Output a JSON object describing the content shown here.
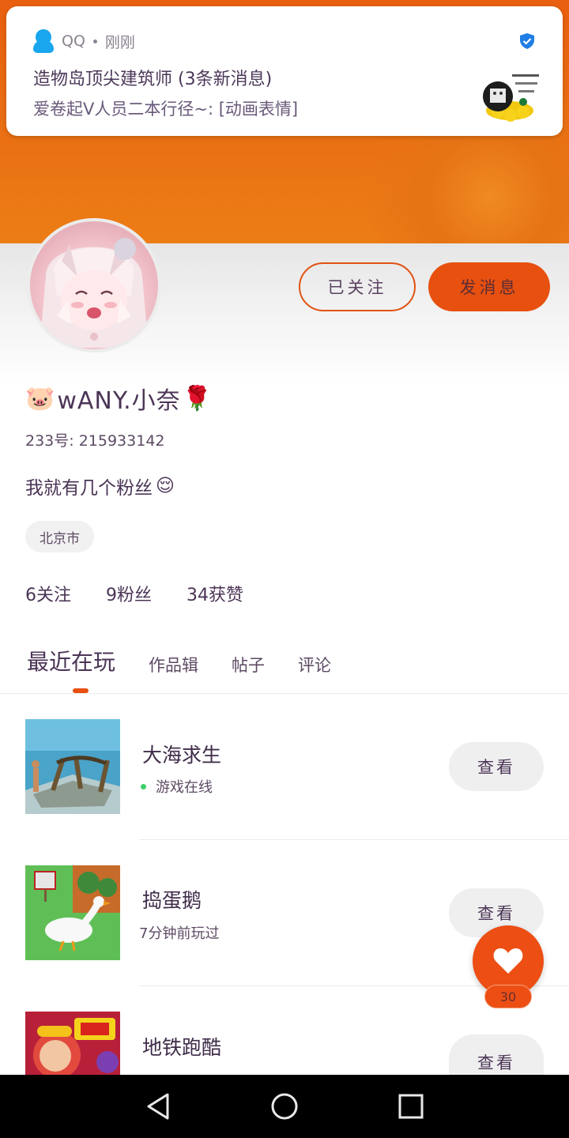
{
  "notification": {
    "app_name": "QQ",
    "time": "刚刚",
    "title": "造物岛顶尖建筑师 (3条新消息)",
    "message": "爱卷起V人员二本行径~: [动画表情]",
    "sticker_icon": "meme-sticker-icon",
    "verified_icon": "verified-shield-icon"
  },
  "profile": {
    "follow_button": "已关注",
    "message_button": "发消息",
    "name_prefix_emoji": "🐷",
    "name": "wANY.小奈",
    "name_suffix_emoji": "🌹",
    "uid": "233号: 215933142",
    "bio": "我就有几个粉丝",
    "bio_emoji": "😌",
    "location": "北京市",
    "stats": {
      "following": "6关注",
      "followers": "9粉丝",
      "likes": "34获赞"
    }
  },
  "tabs": [
    "最近在玩",
    "作品辑",
    "帖子",
    "评论"
  ],
  "games": [
    {
      "name": "大海求生",
      "status": "游戏在线",
      "online": true,
      "button": "查看"
    },
    {
      "name": "捣蛋鹅",
      "status": "7分钟前玩过",
      "online": false,
      "button": "查看"
    },
    {
      "name": "地铁跑酷",
      "status": "",
      "online": false,
      "button": "查看"
    }
  ],
  "fab": {
    "icon": "heart-icon",
    "count": "30"
  },
  "colors": {
    "accent": "#e8500f",
    "header": "#e96d12",
    "online": "#3ecf6b"
  }
}
